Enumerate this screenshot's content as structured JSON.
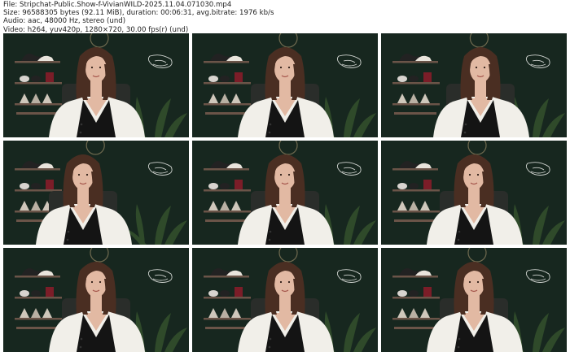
{
  "file_info": {
    "file_line": "File: Stripchat-Public.Show-f-VivianWILD-2025.11.04.071030.mp4",
    "size_line": "Size: 96588305 bytes (92.11 MiB), duration: 00:06:31, avg.bitrate: 1976 kb/s",
    "audio_line": "Audio: aac, 48000 Hz, stereo (und)",
    "video_line": "Video: h264, yuv420p, 1280×720, 30.00 fps(r) (und)"
  },
  "thumbnails": [
    {
      "id": 1,
      "pose": "center"
    },
    {
      "id": 2,
      "pose": "center"
    },
    {
      "id": 3,
      "pose": "right"
    },
    {
      "id": 4,
      "pose": "left"
    },
    {
      "id": 5,
      "pose": "center"
    },
    {
      "id": 6,
      "pose": "center"
    },
    {
      "id": 7,
      "pose": "center"
    },
    {
      "id": 8,
      "pose": "center"
    },
    {
      "id": 9,
      "pose": "center"
    }
  ],
  "colors": {
    "wall": "#17271f",
    "cardigan": "#f1efe9",
    "top": "#141414",
    "hair": "#4a2e22",
    "skin": "#e2b9a3",
    "plant": "#2f4a2a",
    "shelf": "#6b5448"
  }
}
